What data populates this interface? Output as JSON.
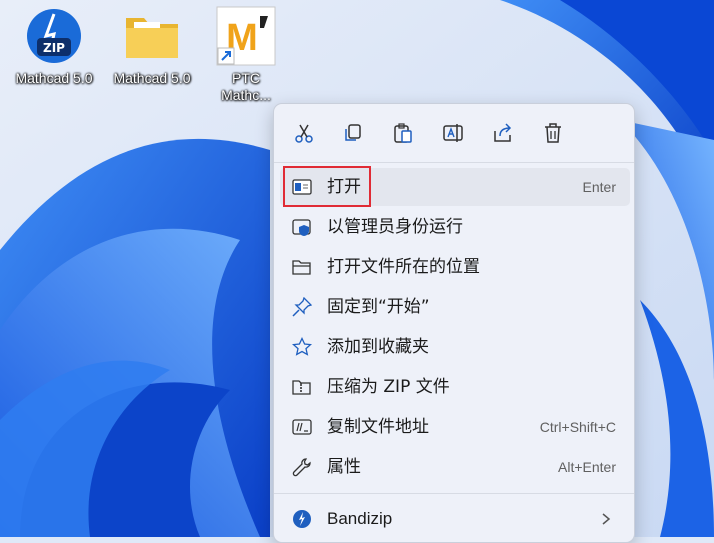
{
  "desktop": {
    "icons": [
      {
        "label": "Mathcad 5.0",
        "icon": "zip-archive-icon"
      },
      {
        "label": "Mathcad 5.0",
        "icon": "folder-icon"
      },
      {
        "label": "PTC\nMathc...",
        "icon": "ptc-mathcad-shortcut-icon"
      }
    ]
  },
  "context_menu": {
    "toolbar": [
      "cut-icon",
      "copy-icon",
      "paste-icon",
      "rename-icon",
      "share-icon",
      "delete-icon"
    ],
    "items": [
      {
        "label": "打开",
        "shortcut": "Enter",
        "icon": "open-window-icon"
      },
      {
        "label": "以管理员身份运行",
        "shortcut": "",
        "icon": "run-as-admin-icon"
      },
      {
        "label": "打开文件所在的位置",
        "shortcut": "",
        "icon": "folder-open-icon"
      },
      {
        "label": "固定到“开始”",
        "shortcut": "",
        "icon": "pin-icon"
      },
      {
        "label": "添加到收藏夹",
        "shortcut": "",
        "icon": "star-icon"
      },
      {
        "label": "压缩为 ZIP 文件",
        "shortcut": "",
        "icon": "zip-folder-icon"
      },
      {
        "label": "复制文件地址",
        "shortcut": "Ctrl+Shift+C",
        "icon": "copy-path-icon"
      },
      {
        "label": "属性",
        "shortcut": "Alt+Enter",
        "icon": "wrench-icon"
      },
      {
        "label": "Bandizip",
        "shortcut": "",
        "icon": "bandizip-icon"
      }
    ]
  },
  "colors": {
    "highlight_box": "#e02b35",
    "accent": "#1a5fd6",
    "menu_bg": "#eef1f9"
  }
}
